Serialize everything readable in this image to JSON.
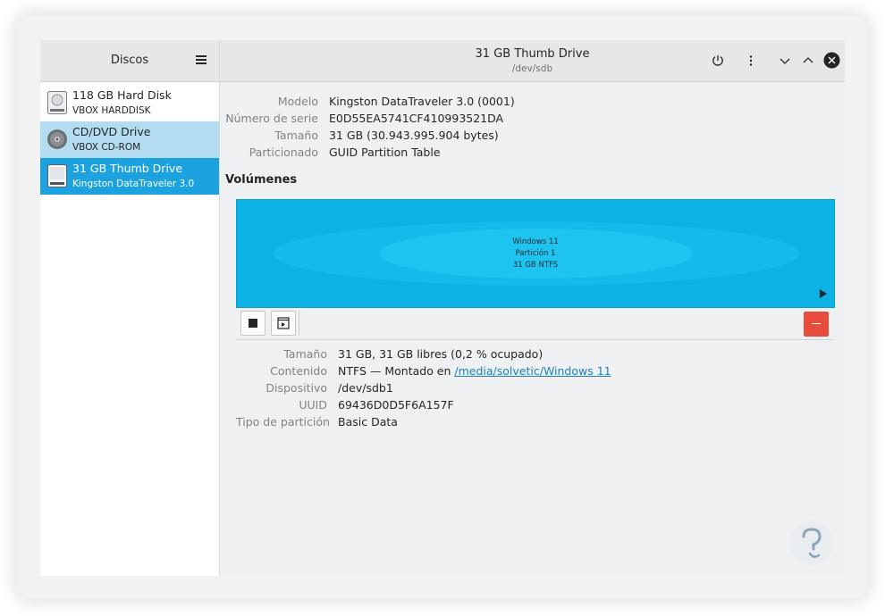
{
  "sidebar": {
    "title": "Discos",
    "disks": [
      {
        "name": "118 GB Hard Disk",
        "model": "VBOX HARDDISK",
        "icon": "hard-disk-icon"
      },
      {
        "name": "CD/DVD Drive",
        "model": "VBOX CD-ROM",
        "icon": "optical-disc-icon"
      },
      {
        "name": "31 GB Thumb Drive",
        "model": "Kingston DataTraveler 3.0",
        "icon": "thumb-drive-icon"
      }
    ]
  },
  "header": {
    "title": "31 GB Thumb Drive",
    "subtitle": "/dev/sdb"
  },
  "drive": {
    "labels": {
      "model": "Modelo",
      "serial": "Número de serie",
      "size": "Tamaño",
      "partitioning": "Particionado"
    },
    "values": {
      "model": "Kingston DataTraveler 3.0 (0001)",
      "serial": "E0D55EA5741CF410993521DA",
      "size": "31 GB (30.943.995.904 bytes)",
      "partitioning": "GUID Partition Table"
    }
  },
  "volumes": {
    "heading": "Volúmenes",
    "partition": {
      "name": "Windows 11",
      "partition": "Partición 1",
      "desc": "31 GB NTFS"
    }
  },
  "volume_details": {
    "labels": {
      "size": "Tamaño",
      "contents": "Contenido",
      "device": "Dispositivo",
      "uuid": "UUID",
      "type": "Tipo de partición"
    },
    "values": {
      "size": "31 GB, 31 GB libres (0,2 % ocupado)",
      "contents_prefix": "NTFS — Montado en ",
      "mount_link": "/media/solvetic/Windows 11",
      "device": "/dev/sdb1",
      "uuid": "69436D0D5F6A157F",
      "type": "Basic Data"
    }
  },
  "colors": {
    "selected": "#1da2e0",
    "hover": "#b3dcf0",
    "volume": "#0cb2e3",
    "delete": "#e74c3c"
  }
}
